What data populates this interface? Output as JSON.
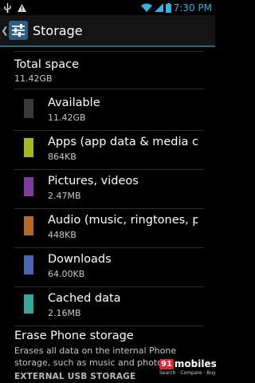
{
  "status_bar": {
    "time": "7:30",
    "time_suffix": "PM"
  },
  "action_bar": {
    "title": "Storage",
    "back_icon": "chevron-left-icon",
    "app_icon": "settings-sliders-icon"
  },
  "total": {
    "title": "Total space",
    "value": "11.42GB"
  },
  "items": [
    {
      "label": "Available",
      "size": "11.42GB",
      "color": "#3a3a3a"
    },
    {
      "label": "Apps (app data & media content)",
      "size": "864KB",
      "color": "#a4b820"
    },
    {
      "label": "Pictures, videos",
      "size": "2.47MB",
      "color": "#7f3d99"
    },
    {
      "label": "Audio (music, ringtones, podcasts, etc.)",
      "size": "448KB",
      "color": "#b56a2c"
    },
    {
      "label": "Downloads",
      "size": "64.00KB",
      "color": "#4a66b0"
    },
    {
      "label": "Cached data",
      "size": "2.16MB",
      "color": "#34a89a"
    }
  ],
  "erase": {
    "title": "Erase Phone storage",
    "description": "Erases all data on the internal Phone storage, such as music and photos"
  },
  "section_header": "EXTERNAL USB STORAGE",
  "watermark": {
    "number": "91",
    "text": "mobiles",
    "tagline": "Search · Compare · Buy"
  },
  "colors": {
    "accent": "#33b5e5",
    "background": "#000000",
    "action_bar": "#141414"
  }
}
